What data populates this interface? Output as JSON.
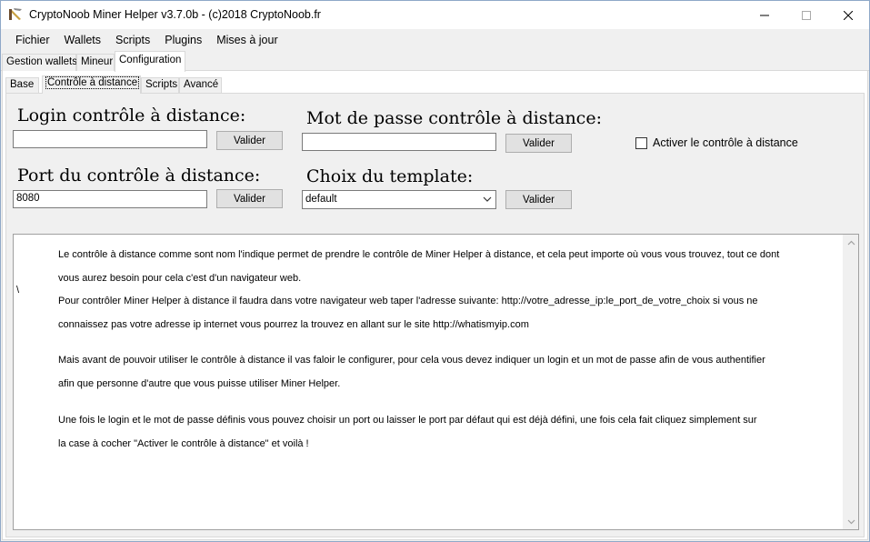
{
  "window": {
    "title": "CryptoNoob Miner Helper v3.7.0b - (c)2018 CryptoNoob.fr"
  },
  "menu": [
    "Fichier",
    "Wallets",
    "Scripts",
    "Plugins",
    "Mises à jour"
  ],
  "main_tabs": [
    "Gestion wallets",
    "Mineur",
    "Configuration"
  ],
  "sub_tabs": [
    "Base",
    "Contrôle à distance",
    "Scripts",
    "Avancé"
  ],
  "form": {
    "login_label": "Login contrôle à distance:",
    "login_value": "",
    "password_label": "Mot de passe contrôle à distance:",
    "password_value": "",
    "port_label": "Port du contrôle à distance:",
    "port_value": "8080",
    "template_label": "Choix du template:",
    "template_value": "default",
    "validate_label": "Valider",
    "enable_label": "Activer le contrôle à distance"
  },
  "help": {
    "backslash": "\\",
    "lines": [
      "Le contrôle à distance comme sont nom l'indique permet de prendre le contrôle de Miner Helper à distance, et cela peut importe où vous vous trouvez, tout ce dont",
      "vous aurez besoin pour cela c'est d'un navigateur web.",
      "Pour contrôler Miner Helper à distance il faudra dans votre navigateur web taper l'adresse suivante: http://votre_adresse_ip:le_port_de_votre_choix si vous ne",
      "connaissez pas votre adresse ip internet vous pourrez la trouvez en allant sur le site http://whatismyip.com",
      "Mais avant de pouvoir utiliser le contrôle à distance il vas faloir le configurer, pour cela vous devez indiquer un login et un mot de passe afin de vous authentifier",
      "afin que personne d'autre que vous puisse utiliser Miner Helper.",
      "Une fois le login et le mot de passe définis vous pouvez choisir un port ou laisser le port par défaut qui est déjà défini, une fois cela fait cliquez simplement sur",
      "la case à cocher \"Activer le contrôle à distance\" et voilà !"
    ]
  }
}
